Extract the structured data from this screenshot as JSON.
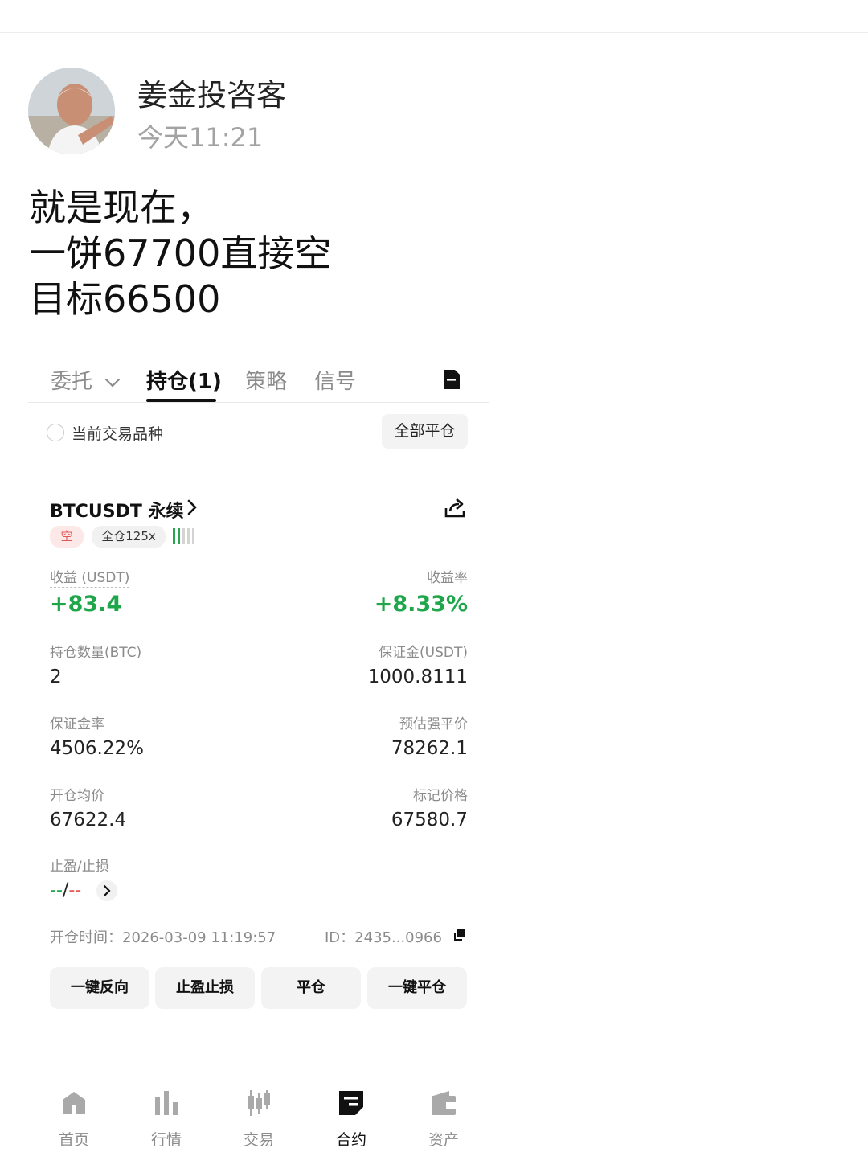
{
  "author": {
    "name": "姜金投咨客",
    "time": "今天11:21"
  },
  "post": {
    "lines": [
      "就是现在，",
      "一饼67700直接空",
      "目标66500"
    ]
  },
  "tabs": {
    "orders": "委托",
    "positions": "持仓(1)",
    "strategy": "策略",
    "signals": "信号"
  },
  "filter": {
    "label": "当前交易品种",
    "close_all": "全部平仓"
  },
  "position": {
    "symbol": "BTCUSDT 永续",
    "side": "空",
    "leverage": "全仓125x",
    "risk_level": 0.4,
    "pnl_label": "收益 (USDT)",
    "pnl_value": "+83.4",
    "roe_label": "收益率",
    "roe_value": "+8.33%",
    "size_label": "持仓数量(BTC)",
    "size_value": "2",
    "margin_label": "保证金(USDT)",
    "margin_value": "1000.8111",
    "margin_ratio_label": "保证金率",
    "margin_ratio_value": "4506.22%",
    "liq_label": "预估强平价",
    "liq_value": "78262.1",
    "entry_label": "开仓均价",
    "entry_value": "67622.4",
    "mark_label": "标记价格",
    "mark_value": "67580.7",
    "tpsl_label": "止盈/止损",
    "tp_value": "--",
    "tpsl_sep": "/",
    "sl_value": "--",
    "open_time": "开仓时间：2026-03-09 11:19:57",
    "order_id": "ID：2435...0966"
  },
  "actions": {
    "reverse": "一键反向",
    "tpsl": "止盈止损",
    "close": "平仓",
    "quick_close": "一键平仓"
  },
  "nav": [
    {
      "label": "首页",
      "icon": "home-icon"
    },
    {
      "label": "行情",
      "icon": "market-chart-icon"
    },
    {
      "label": "交易",
      "icon": "candlestick-icon"
    },
    {
      "label": "合约",
      "icon": "futures-icon"
    },
    {
      "label": "资产",
      "icon": "wallet-icon"
    }
  ],
  "colors": {
    "profit": "#1fa64a",
    "short": "#e45757",
    "text": "#111111",
    "muted": "#8b8b8b"
  }
}
